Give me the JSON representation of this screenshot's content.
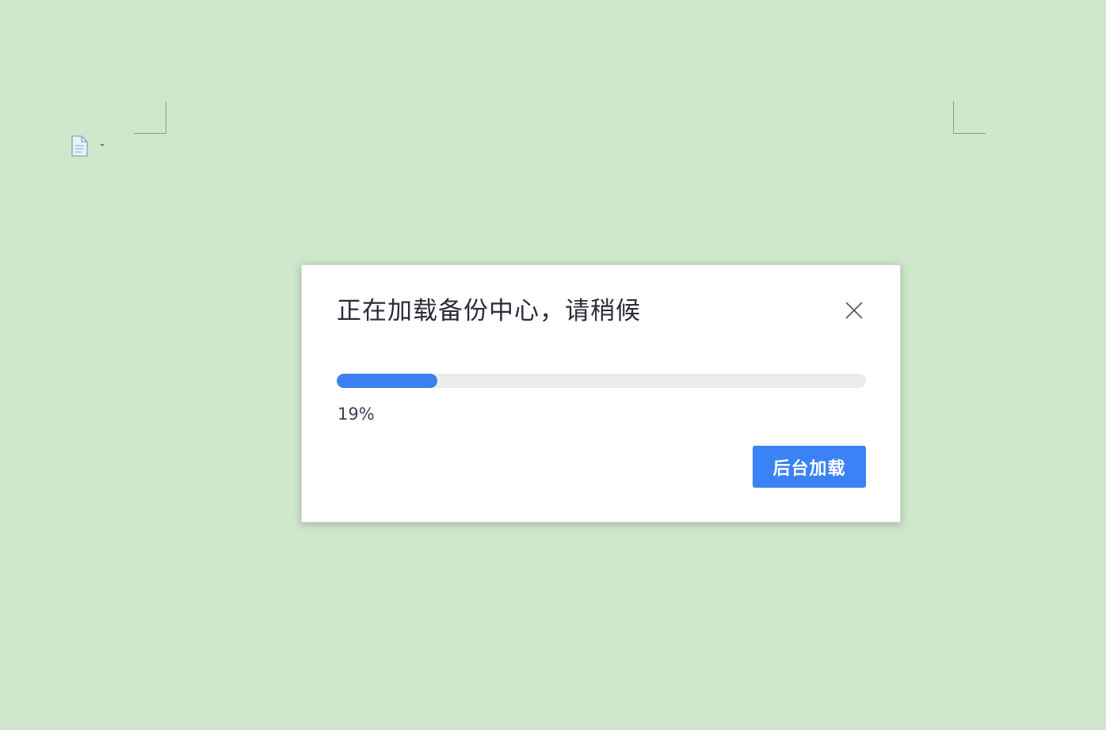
{
  "dialog": {
    "title": "正在加载备份中心，请稍候",
    "progress_fraction": 0.19,
    "progress_label": "19%",
    "background_load_label": "后台加载",
    "close_icon": "close-icon"
  },
  "page": {
    "paste_options_icon": "document-icon",
    "paste_options_caret": "chevron-down-icon"
  },
  "colors": {
    "background": "#cfe8cc",
    "accent": "#3b82f6",
    "progress_fill": "#3b7ff0",
    "progress_track": "#ececee"
  }
}
